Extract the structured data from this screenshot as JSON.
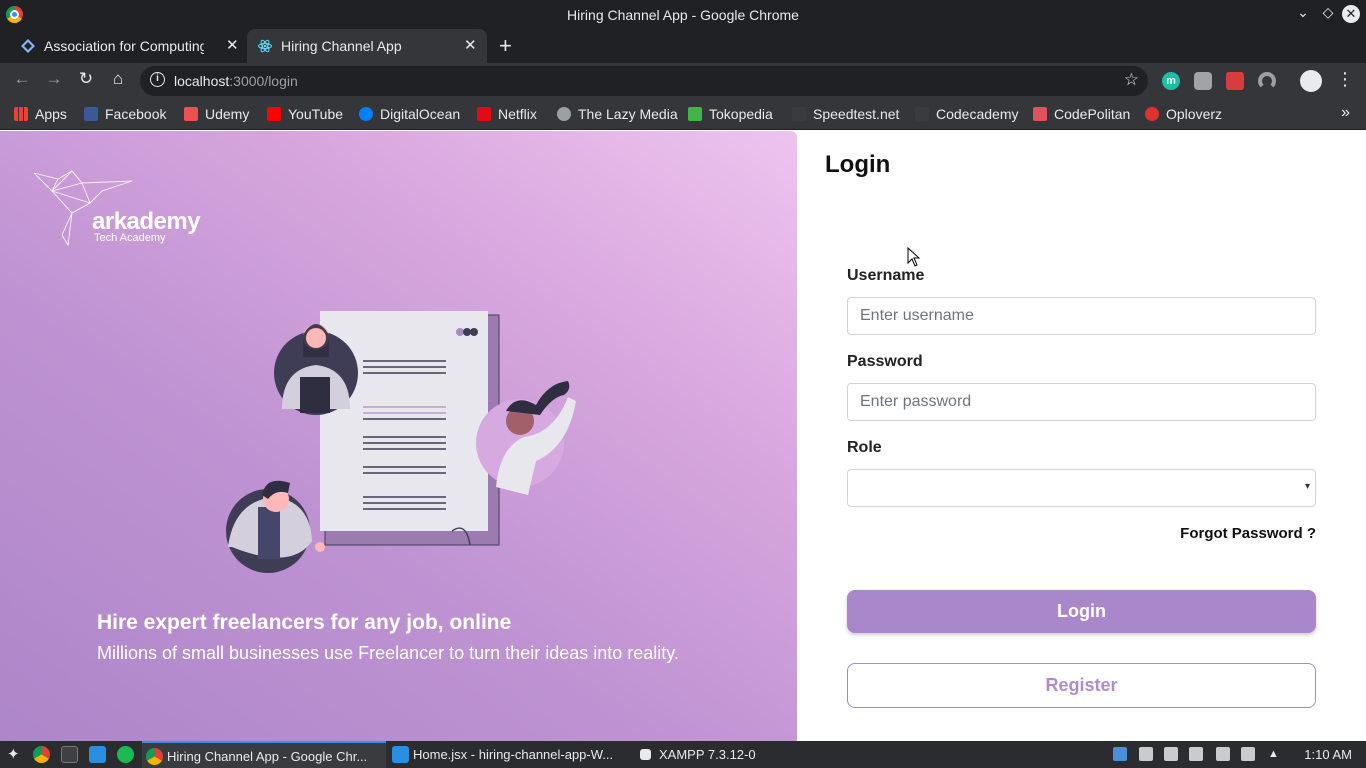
{
  "window": {
    "title": "Hiring Channel App - Google Chrome"
  },
  "tabs": [
    {
      "label": "Association for Computing Machinery",
      "active": false
    },
    {
      "label": "Hiring Channel App",
      "active": true
    }
  ],
  "toolbar": {
    "url_host": "localhost",
    "url_rest": ":3000/login"
  },
  "bookmarks": [
    {
      "label": "Apps",
      "icon": "apps-grid-icon",
      "color": "#4285f4"
    },
    {
      "label": "Facebook",
      "icon": "facebook-icon",
      "color": "#3b5998"
    },
    {
      "label": "Udemy",
      "icon": "udemy-icon",
      "color": "#ec5252"
    },
    {
      "label": "YouTube",
      "icon": "youtube-icon",
      "color": "#ff0000"
    },
    {
      "label": "DigitalOcean",
      "icon": "digitalocean-icon",
      "color": "#0080ff"
    },
    {
      "label": "Netflix",
      "icon": "netflix-icon",
      "color": "#e50914"
    },
    {
      "label": "The Lazy Media",
      "icon": "globe-icon",
      "color": "#9aa0a6"
    },
    {
      "label": "Tokopedia",
      "icon": "tokopedia-icon",
      "color": "#42b549"
    },
    {
      "label": "Speedtest.net",
      "icon": "speedtest-icon",
      "color": "#3a3b3f"
    },
    {
      "label": "Codecademy",
      "icon": "codecademy-icon",
      "color": "#3a3b3f"
    },
    {
      "label": "CodePolitan",
      "icon": "codepolitan-icon",
      "color": "#e0525c"
    },
    {
      "label": "Oploverz",
      "icon": "oploverz-icon",
      "color": "#e0312f"
    }
  ],
  "hero": {
    "brand": "arkademy",
    "brand_sub": "Tech Academy",
    "headline": "Hire expert freelancers for any job, online",
    "subline": "Millions of small businesses use Freelancer to turn their ideas into reality."
  },
  "login": {
    "title": "Login",
    "username_label": "Username",
    "username_placeholder": "Enter username",
    "password_label": "Password",
    "password_placeholder": "Enter password",
    "role_label": "Role",
    "role_value": "",
    "forgot": "Forgot Password ?",
    "login_button": "Login",
    "register_button": "Register",
    "accent": "#a987ca"
  },
  "taskbar": {
    "items": [
      {
        "label": "Hiring Channel App - Google Chr..."
      },
      {
        "label": "Home.jsx - hiring-channel-app-W..."
      },
      {
        "label": "XAMPP 7.3.12-0"
      }
    ],
    "clock": "1:10 AM"
  }
}
